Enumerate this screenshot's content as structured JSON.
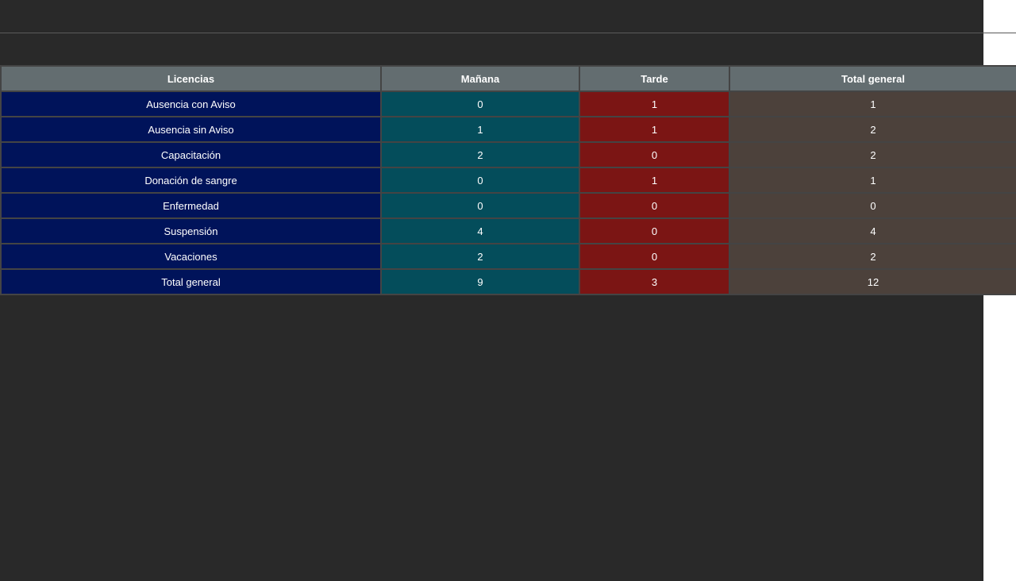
{
  "table": {
    "headers": [
      "Licencias",
      "Mañana",
      "Tarde",
      "Total general"
    ],
    "column_colors": [
      "#00135a",
      "#044d5b",
      "#7b1514",
      "#4c413b"
    ],
    "header_color": "#636d70",
    "rows": [
      [
        "Ausencia con Aviso",
        "0",
        "1",
        "1"
      ],
      [
        "Ausencia sin Aviso",
        "1",
        "1",
        "2"
      ],
      [
        "Capacitación",
        "2",
        "0",
        "2"
      ],
      [
        "Donación de sangre",
        "0",
        "1",
        "1"
      ],
      [
        "Enfermedad",
        "0",
        "0",
        "0"
      ],
      [
        "Suspensión",
        "4",
        "0",
        "4"
      ],
      [
        "Vacaciones",
        "2",
        "0",
        "2"
      ],
      [
        "Total general",
        "9",
        "3",
        "12"
      ]
    ]
  }
}
